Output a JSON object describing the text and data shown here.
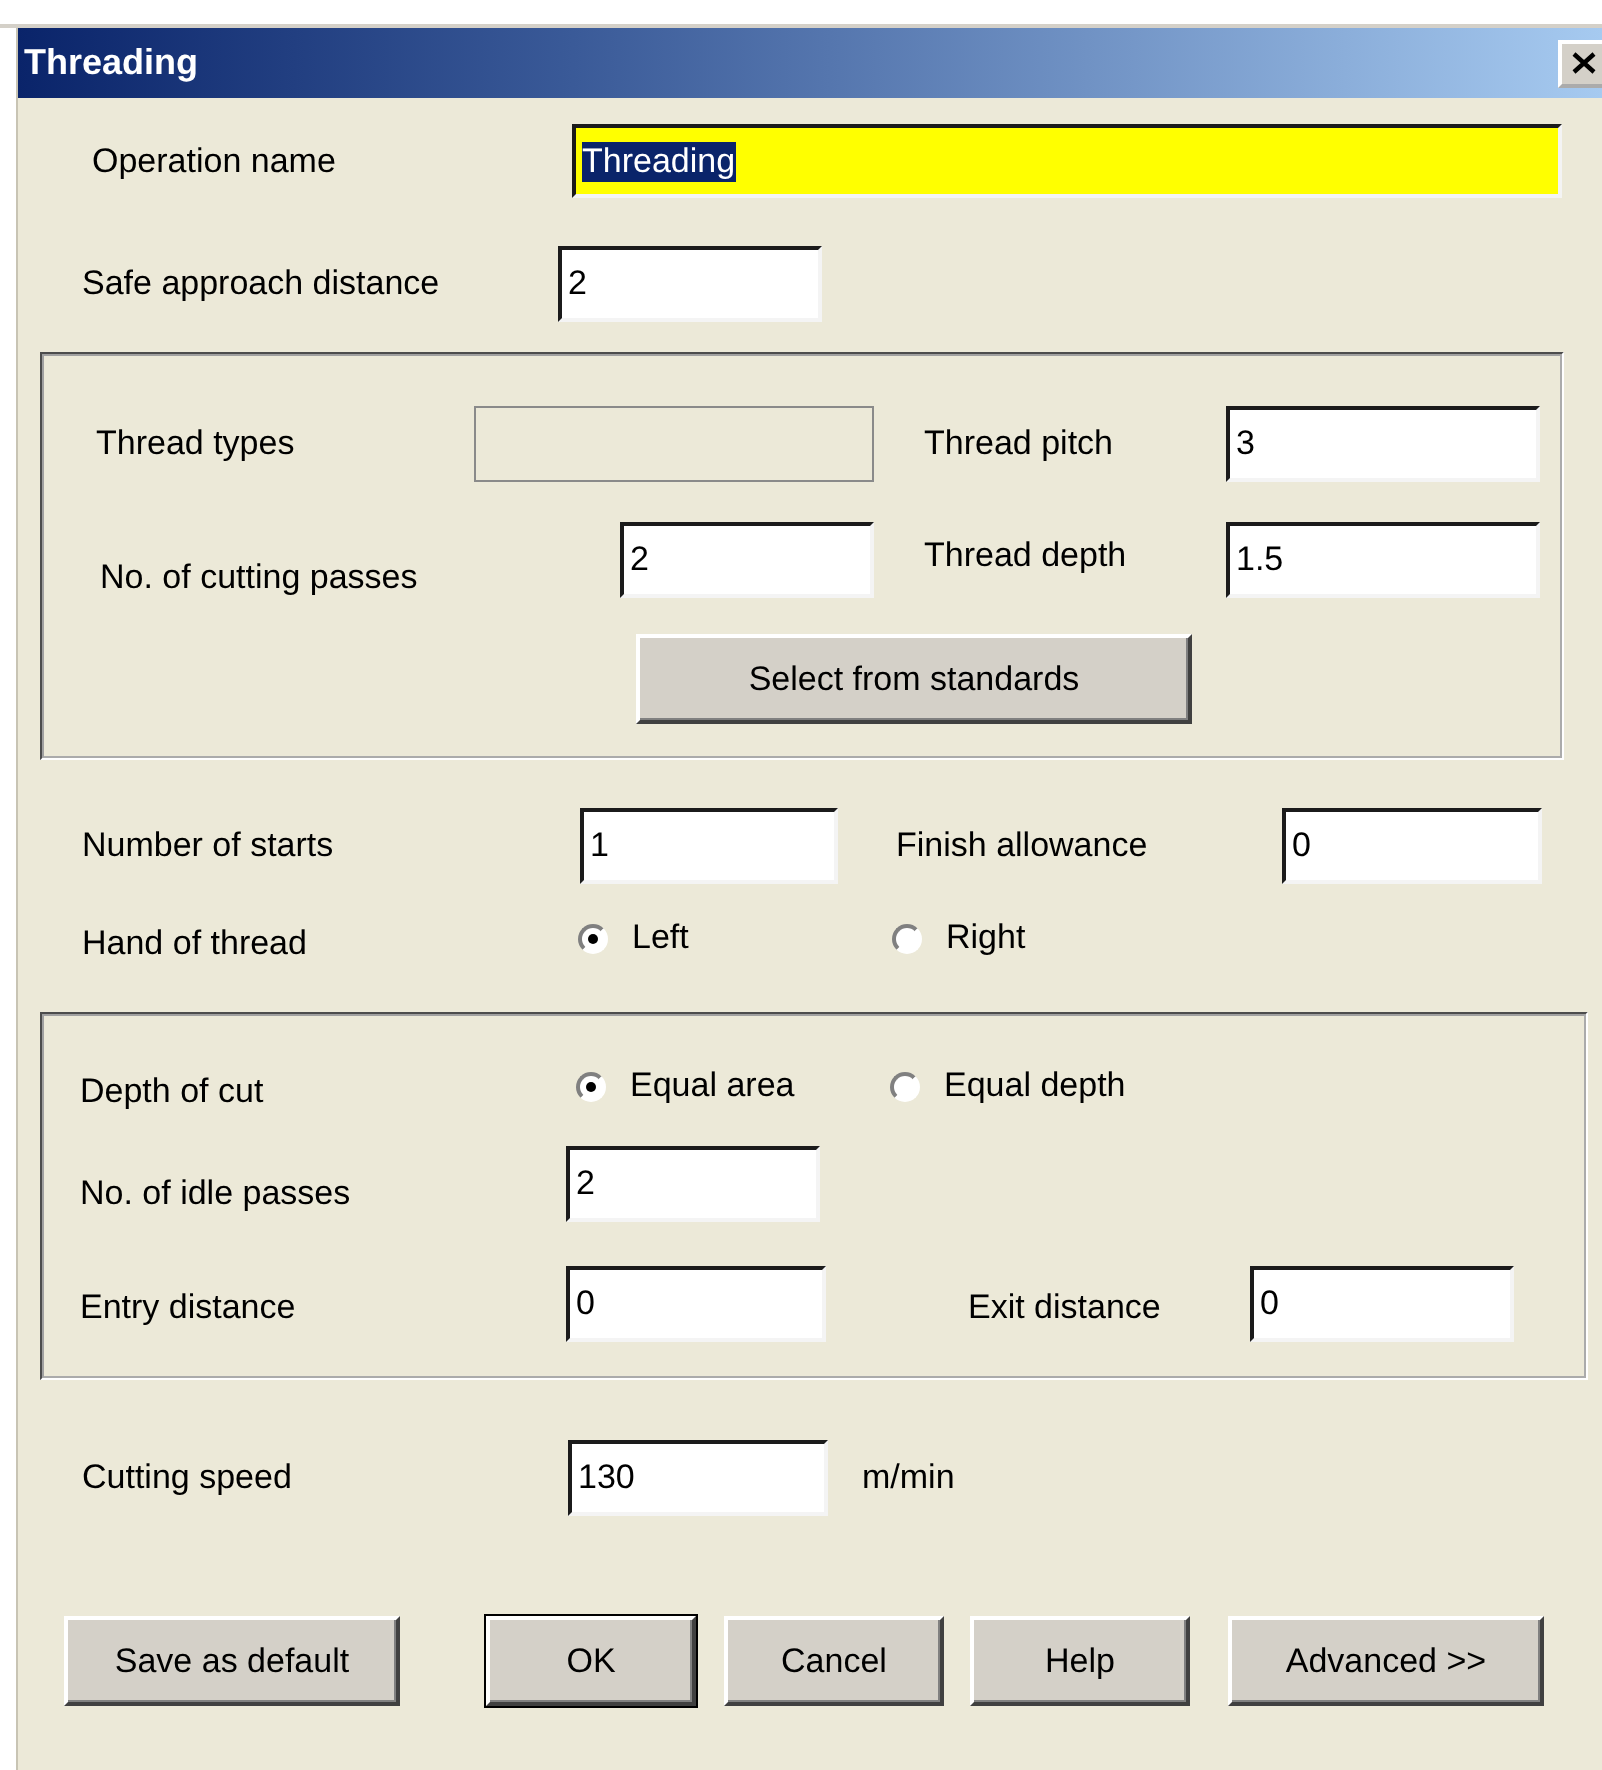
{
  "window": {
    "title": "Threading"
  },
  "operation_name": {
    "label": "Operation name",
    "value": "Threading",
    "highlighted": true,
    "text_selected": true
  },
  "safe_approach_distance": {
    "label": "Safe approach distance",
    "value": "2"
  },
  "thread_group": {
    "thread_types": {
      "label": "Thread types",
      "disabled": true
    },
    "thread_pitch": {
      "label": "Thread pitch",
      "value": "3"
    },
    "cutting_passes": {
      "label": "No. of cutting passes",
      "value": "2"
    },
    "thread_depth": {
      "label": "Thread depth",
      "value": "1.5"
    },
    "standards_button": "Select from standards"
  },
  "number_of_starts": {
    "label": "Number of starts",
    "value": "1"
  },
  "finish_allowance": {
    "label": "Finish allowance",
    "value": "0"
  },
  "hand_of_thread": {
    "label": "Hand of thread",
    "options": [
      {
        "label": "Left",
        "selected": true
      },
      {
        "label": "Right",
        "selected": false
      }
    ]
  },
  "cut_group": {
    "depth_of_cut": {
      "label": "Depth of cut",
      "options": [
        {
          "label": "Equal area",
          "selected": true
        },
        {
          "label": "Equal depth",
          "selected": false
        }
      ]
    },
    "idle_passes": {
      "label": "No. of idle passes",
      "value": "2"
    },
    "entry_distance": {
      "label": "Entry distance",
      "value": "0"
    },
    "exit_distance": {
      "label": "Exit distance",
      "value": "0"
    }
  },
  "cutting_speed": {
    "label": "Cutting speed",
    "value": "130",
    "unit": "m/min"
  },
  "buttons": [
    {
      "label": "Save as default",
      "default": false
    },
    {
      "label": "OK",
      "default": true
    },
    {
      "label": "Cancel",
      "default": false
    },
    {
      "label": "Help",
      "default": false
    },
    {
      "label": "Advanced >>",
      "default": false
    }
  ]
}
